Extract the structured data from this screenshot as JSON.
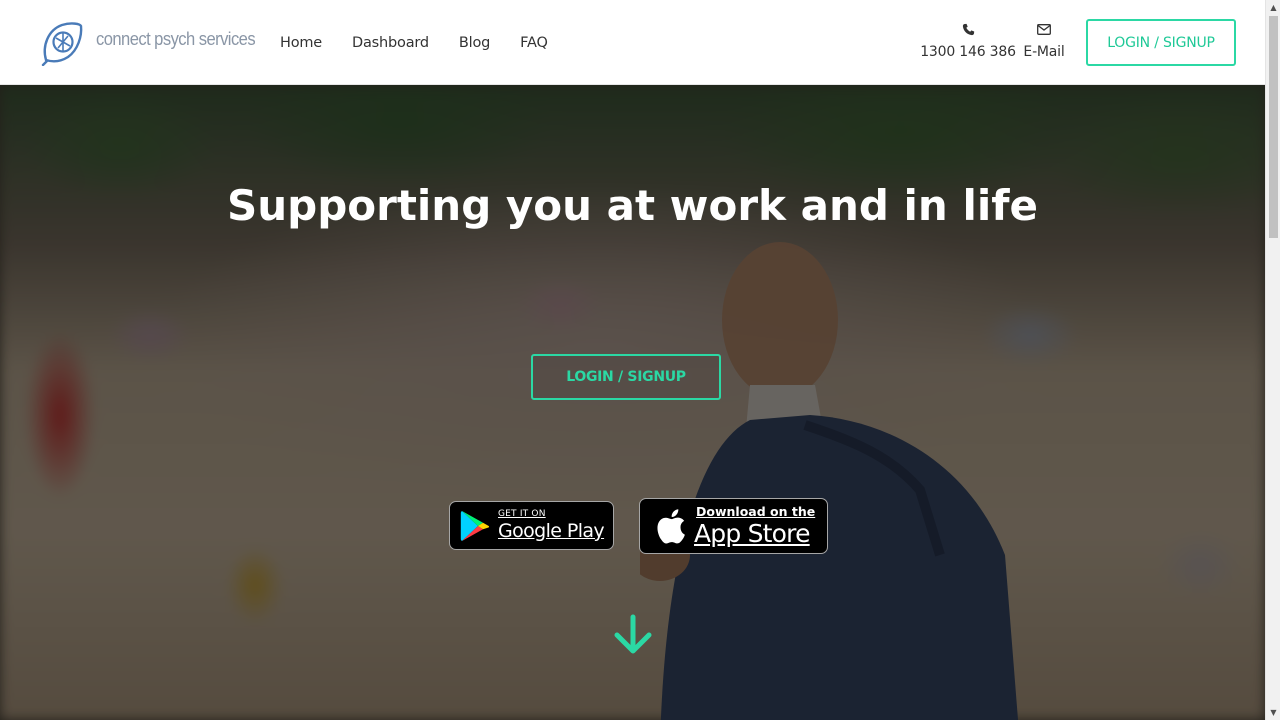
{
  "brand": {
    "name": "connect psych services",
    "accent_color": "#2bd8a4",
    "logo_icon": "leaf-logo-icon"
  },
  "nav": {
    "items": [
      {
        "label": "Home"
      },
      {
        "label": "Dashboard"
      },
      {
        "label": "Blog"
      },
      {
        "label": "FAQ"
      }
    ]
  },
  "contact": {
    "phone": {
      "icon": "phone-icon",
      "label": "1300 146 386"
    },
    "email": {
      "icon": "envelope-icon",
      "label": "E-Mail"
    }
  },
  "header_cta": {
    "label": "LOGIN / SIGNUP"
  },
  "hero": {
    "title": "Supporting you at work and in life",
    "cta_label": "LOGIN / SIGNUP",
    "google_play": {
      "small": "GET IT ON",
      "big": "Google Play",
      "icon": "google-play-icon"
    },
    "app_store": {
      "small": "Download on the",
      "big": "App Store",
      "icon": "apple-icon"
    },
    "scroll_icon": "arrow-down-icon"
  },
  "scrollbar": {
    "up_icon": "triangle-up-icon",
    "down_icon": "triangle-down-icon"
  }
}
